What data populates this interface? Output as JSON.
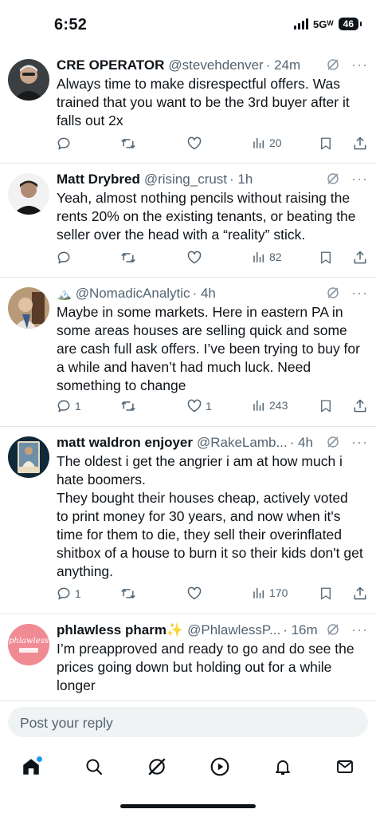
{
  "status": {
    "time": "6:52",
    "network": "5Gᵂ",
    "battery": "46"
  },
  "tweets": [
    {
      "name": "CRE OPERATOR",
      "handle": "@stevehdenver",
      "time": "· 24m",
      "text": "Always time to make disrespectful offers.  Was trained that you want to be the 3rd buyer after it falls out 2x",
      "replies": "",
      "retweets": "",
      "likes": "",
      "views": "20",
      "avatar_color": "#6b6f73"
    },
    {
      "name": "Matt Drybred",
      "handle": "@rising_crust",
      "time": "· 1h",
      "text": "Yeah, almost nothing pencils without raising the rents 20% on the existing tenants, or beating the seller over the head with a “reality” stick.",
      "replies": "",
      "retweets": "",
      "likes": "",
      "views": "82",
      "avatar_color": "#2a2a2a"
    },
    {
      "name": "🏔️",
      "handle": "@NomadicAnalytic",
      "time": "· 4h",
      "text": "Maybe in some markets. Here in eastern PA in some areas houses are selling quick and some are cash full ask offers. I’ve been trying to buy for a while and haven’t had much luck. Need something to change",
      "replies": "1",
      "retweets": "",
      "likes": "1",
      "views": "243",
      "avatar_color": "#a88968"
    },
    {
      "name": "matt waldron enjoyer",
      "handle": "@RakeLamb...",
      "time": "· 4h",
      "text": "The oldest i get the angrier i am at how much i hate boomers.\nThey bought their houses cheap, actively voted to print money for 30 years, and now when it's time for them to die, they sell their overinflated shitbox of a house to burn it so their kids don't get anything.",
      "replies": "1",
      "retweets": "",
      "likes": "",
      "views": "170",
      "avatar_color": "#1f3a4a"
    },
    {
      "name": "phlawless pharm✨",
      "handle": "@PhlawlessP...",
      "time": "· 16m",
      "text": "I’m preapproved and ready to go and do see the prices going down but holding out for a while longer",
      "replies": "",
      "retweets": "",
      "likes": "",
      "views": "",
      "avatar_color": "#f08a93"
    }
  ],
  "avatar_texts": {
    "phlawless": "phlawless"
  },
  "reply": {
    "placeholder": "Post your reply"
  },
  "tabs": [
    "home-icon",
    "search-icon",
    "grok-icon",
    "video-icon",
    "notifications-icon",
    "messages-icon"
  ],
  "colors": {
    "accent": "#1d9bf0",
    "muted": "#536471",
    "text": "#0f1419"
  }
}
